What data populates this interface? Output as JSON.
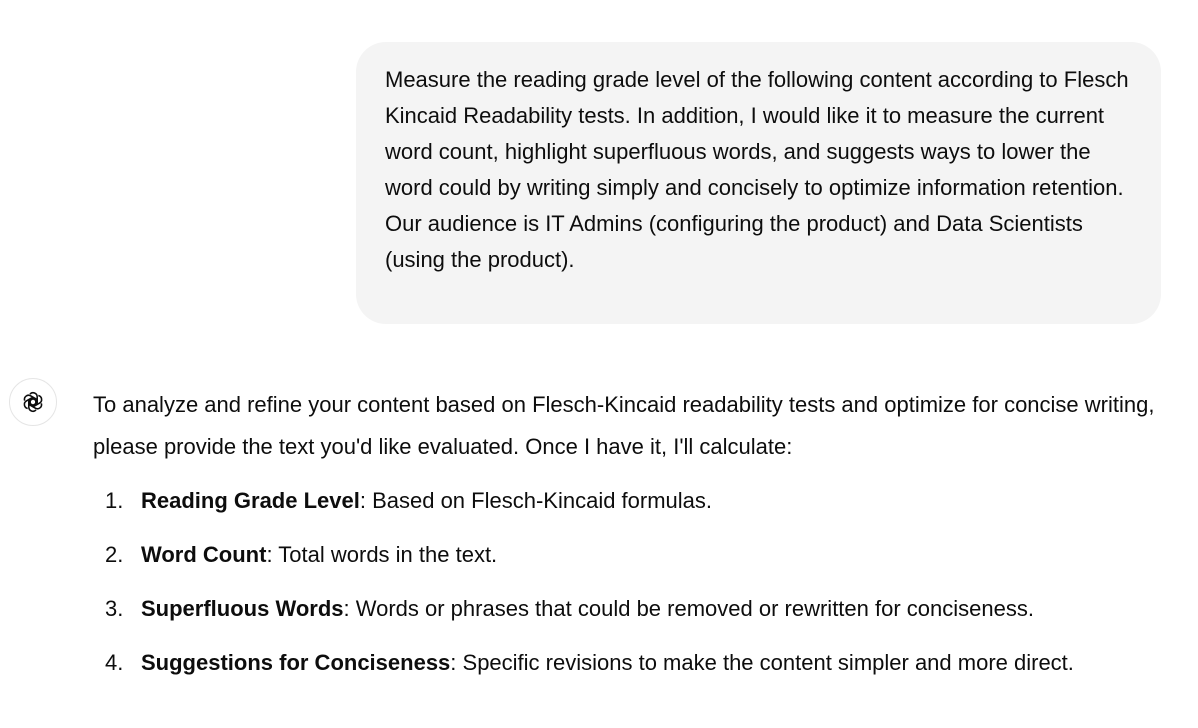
{
  "user_message": {
    "text": "Measure the reading grade level of the following content according to Flesch Kincaid Readability tests. In addition, I would like it to measure the current word count, highlight superfluous words, and suggests ways to lower the word could by writing simply and concisely to optimize information retention. Our audience is IT Admins (configuring the product) and Data Scientists (using the product)."
  },
  "assistant_message": {
    "avatar_icon": "openai-logo-icon",
    "intro": "To analyze and refine your content based on Flesch-Kincaid readability tests and optimize for concise writing, please provide the text you'd like evaluated. Once I have it, I'll calculate:",
    "items": [
      {
        "number": "1.",
        "title": "Reading Grade Level",
        "description": ": Based on Flesch-Kincaid formulas."
      },
      {
        "number": "2.",
        "title": "Word Count",
        "description": ": Total words in the text."
      },
      {
        "number": "3.",
        "title": "Superfluous Words",
        "description": ": Words or phrases that could be removed or rewritten for conciseness."
      },
      {
        "number": "4.",
        "title": "Suggestions for Conciseness",
        "description": ": Specific revisions to make the content simpler and more direct."
      }
    ]
  },
  "colors": {
    "user_bubble_bg": "#f4f4f4",
    "text": "#0d0d0d",
    "avatar_border": "#e5e5e5"
  }
}
